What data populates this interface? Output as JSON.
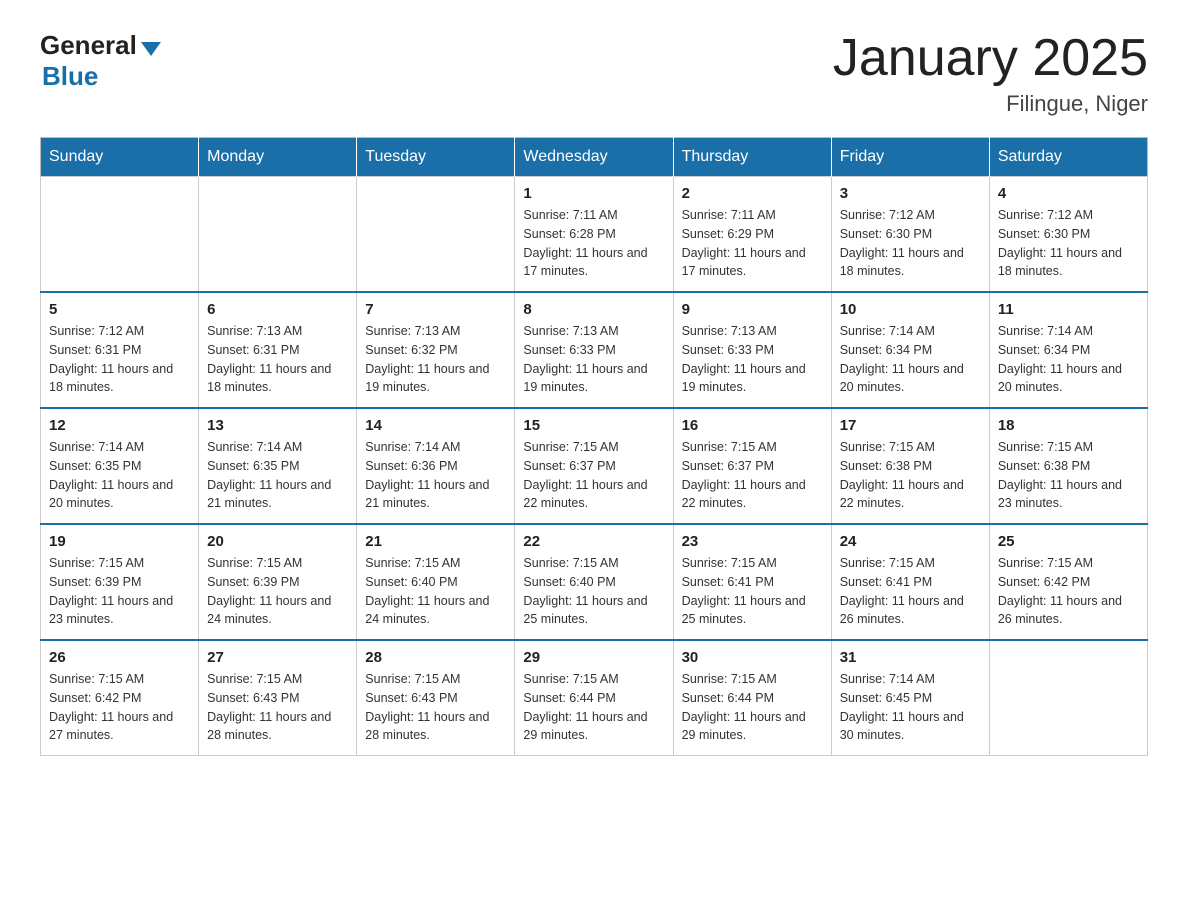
{
  "logo": {
    "general": "General",
    "blue": "Blue"
  },
  "title": "January 2025",
  "subtitle": "Filingue, Niger",
  "days_of_week": [
    "Sunday",
    "Monday",
    "Tuesday",
    "Wednesday",
    "Thursday",
    "Friday",
    "Saturday"
  ],
  "weeks": [
    [
      {
        "day": "",
        "info": ""
      },
      {
        "day": "",
        "info": ""
      },
      {
        "day": "",
        "info": ""
      },
      {
        "day": "1",
        "info": "Sunrise: 7:11 AM\nSunset: 6:28 PM\nDaylight: 11 hours and 17 minutes."
      },
      {
        "day": "2",
        "info": "Sunrise: 7:11 AM\nSunset: 6:29 PM\nDaylight: 11 hours and 17 minutes."
      },
      {
        "day": "3",
        "info": "Sunrise: 7:12 AM\nSunset: 6:30 PM\nDaylight: 11 hours and 18 minutes."
      },
      {
        "day": "4",
        "info": "Sunrise: 7:12 AM\nSunset: 6:30 PM\nDaylight: 11 hours and 18 minutes."
      }
    ],
    [
      {
        "day": "5",
        "info": "Sunrise: 7:12 AM\nSunset: 6:31 PM\nDaylight: 11 hours and 18 minutes."
      },
      {
        "day": "6",
        "info": "Sunrise: 7:13 AM\nSunset: 6:31 PM\nDaylight: 11 hours and 18 minutes."
      },
      {
        "day": "7",
        "info": "Sunrise: 7:13 AM\nSunset: 6:32 PM\nDaylight: 11 hours and 19 minutes."
      },
      {
        "day": "8",
        "info": "Sunrise: 7:13 AM\nSunset: 6:33 PM\nDaylight: 11 hours and 19 minutes."
      },
      {
        "day": "9",
        "info": "Sunrise: 7:13 AM\nSunset: 6:33 PM\nDaylight: 11 hours and 19 minutes."
      },
      {
        "day": "10",
        "info": "Sunrise: 7:14 AM\nSunset: 6:34 PM\nDaylight: 11 hours and 20 minutes."
      },
      {
        "day": "11",
        "info": "Sunrise: 7:14 AM\nSunset: 6:34 PM\nDaylight: 11 hours and 20 minutes."
      }
    ],
    [
      {
        "day": "12",
        "info": "Sunrise: 7:14 AM\nSunset: 6:35 PM\nDaylight: 11 hours and 20 minutes."
      },
      {
        "day": "13",
        "info": "Sunrise: 7:14 AM\nSunset: 6:35 PM\nDaylight: 11 hours and 21 minutes."
      },
      {
        "day": "14",
        "info": "Sunrise: 7:14 AM\nSunset: 6:36 PM\nDaylight: 11 hours and 21 minutes."
      },
      {
        "day": "15",
        "info": "Sunrise: 7:15 AM\nSunset: 6:37 PM\nDaylight: 11 hours and 22 minutes."
      },
      {
        "day": "16",
        "info": "Sunrise: 7:15 AM\nSunset: 6:37 PM\nDaylight: 11 hours and 22 minutes."
      },
      {
        "day": "17",
        "info": "Sunrise: 7:15 AM\nSunset: 6:38 PM\nDaylight: 11 hours and 22 minutes."
      },
      {
        "day": "18",
        "info": "Sunrise: 7:15 AM\nSunset: 6:38 PM\nDaylight: 11 hours and 23 minutes."
      }
    ],
    [
      {
        "day": "19",
        "info": "Sunrise: 7:15 AM\nSunset: 6:39 PM\nDaylight: 11 hours and 23 minutes."
      },
      {
        "day": "20",
        "info": "Sunrise: 7:15 AM\nSunset: 6:39 PM\nDaylight: 11 hours and 24 minutes."
      },
      {
        "day": "21",
        "info": "Sunrise: 7:15 AM\nSunset: 6:40 PM\nDaylight: 11 hours and 24 minutes."
      },
      {
        "day": "22",
        "info": "Sunrise: 7:15 AM\nSunset: 6:40 PM\nDaylight: 11 hours and 25 minutes."
      },
      {
        "day": "23",
        "info": "Sunrise: 7:15 AM\nSunset: 6:41 PM\nDaylight: 11 hours and 25 minutes."
      },
      {
        "day": "24",
        "info": "Sunrise: 7:15 AM\nSunset: 6:41 PM\nDaylight: 11 hours and 26 minutes."
      },
      {
        "day": "25",
        "info": "Sunrise: 7:15 AM\nSunset: 6:42 PM\nDaylight: 11 hours and 26 minutes."
      }
    ],
    [
      {
        "day": "26",
        "info": "Sunrise: 7:15 AM\nSunset: 6:42 PM\nDaylight: 11 hours and 27 minutes."
      },
      {
        "day": "27",
        "info": "Sunrise: 7:15 AM\nSunset: 6:43 PM\nDaylight: 11 hours and 28 minutes."
      },
      {
        "day": "28",
        "info": "Sunrise: 7:15 AM\nSunset: 6:43 PM\nDaylight: 11 hours and 28 minutes."
      },
      {
        "day": "29",
        "info": "Sunrise: 7:15 AM\nSunset: 6:44 PM\nDaylight: 11 hours and 29 minutes."
      },
      {
        "day": "30",
        "info": "Sunrise: 7:15 AM\nSunset: 6:44 PM\nDaylight: 11 hours and 29 minutes."
      },
      {
        "day": "31",
        "info": "Sunrise: 7:14 AM\nSunset: 6:45 PM\nDaylight: 11 hours and 30 minutes."
      },
      {
        "day": "",
        "info": ""
      }
    ]
  ]
}
